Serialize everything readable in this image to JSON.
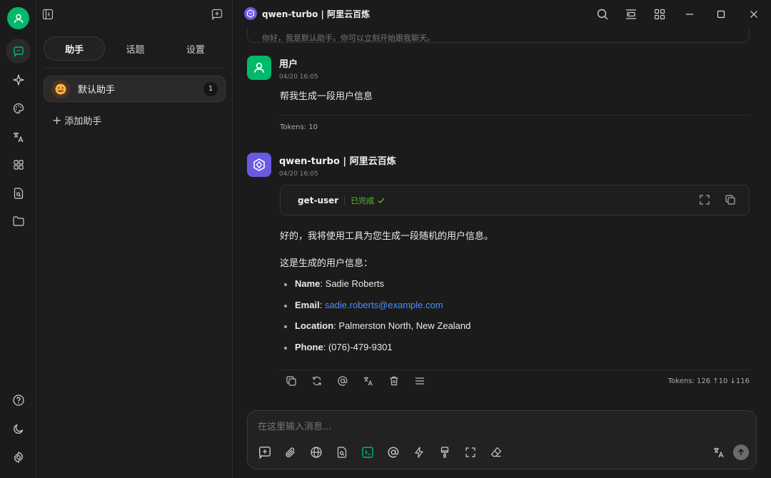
{
  "panel": {
    "tabs": [
      {
        "label": "助手",
        "active": true
      },
      {
        "label": "话题",
        "active": false
      },
      {
        "label": "设置",
        "active": false
      }
    ],
    "assistant": {
      "name": "默认助手",
      "count": "1"
    },
    "add_assistant": "添加助手"
  },
  "header": {
    "title": "qwen-turbo | 阿里云百炼"
  },
  "chat": {
    "clipped_text": "你好，我是默认助手。你可以立刻开始跟我聊天。",
    "user_msg": {
      "name": "用户",
      "time": "04/20 16:05",
      "text": "帮我生成一段用户信息",
      "tokens": "Tokens: 10"
    },
    "bot_msg": {
      "name": "qwen-turbo | 阿里云百炼",
      "time": "04/20 16:05",
      "tool": {
        "name": "get-user",
        "status": "已完成"
      },
      "intro": "好的，我将使用工具为您生成一段随机的用户信息。",
      "lead": "这是生成的用户信息：",
      "fields": [
        {
          "label": "Name",
          "value": "Sadie Roberts"
        },
        {
          "label": "Email",
          "value": "sadie.roberts@example.com"
        },
        {
          "label": "Location",
          "value": "Palmerston North, New Zealand"
        },
        {
          "label": "Phone",
          "value": "(076)-479-9301"
        }
      ],
      "tokens": "Tokens: 126 ↑10 ↓116"
    }
  },
  "composer": {
    "placeholder": "在这里输入消息..."
  },
  "colors": {
    "accent": "#00b96b",
    "link": "#4a90ff",
    "success": "#52c41a",
    "model": "#6a5ae0"
  }
}
